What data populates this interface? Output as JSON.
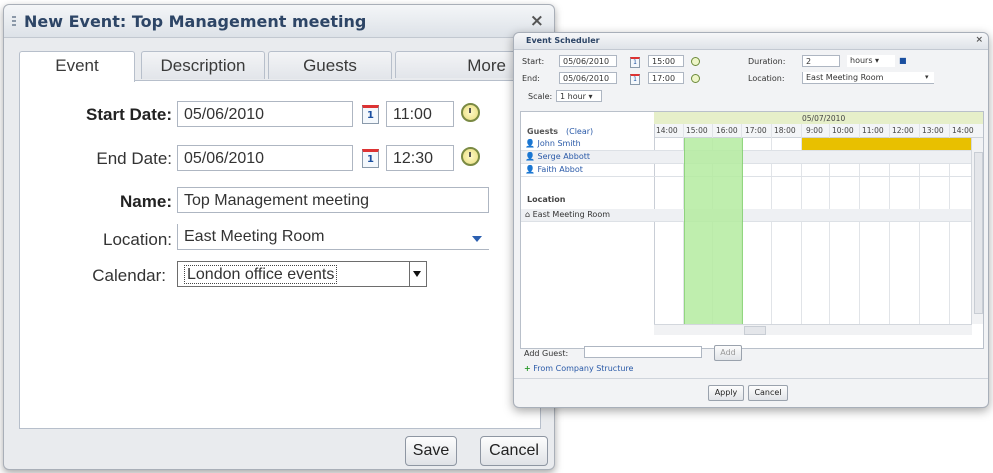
{
  "event_dialog": {
    "title": "New Event: Top Management meeting",
    "close_glyph": "×",
    "tabs": [
      {
        "label": "Event",
        "active": true
      },
      {
        "label": "Description",
        "active": false
      },
      {
        "label": "Guests",
        "active": false
      },
      {
        "label": "More",
        "active": false
      }
    ],
    "start_date": {
      "label": "Start Date:",
      "date": "05/06/2010",
      "time": "11:00"
    },
    "end_date": {
      "label": "End Date:",
      "date": "05/06/2010",
      "time": "12:30"
    },
    "name": {
      "label": "Name:",
      "value": "Top Management meeting"
    },
    "location": {
      "label": "Location:",
      "value": "East Meeting Room"
    },
    "calendar": {
      "label": "Calendar:",
      "value": "London office events"
    },
    "calendar_icon_text": "1",
    "save_label": "Save",
    "cancel_label": "Cancel"
  },
  "scheduler": {
    "title": "Event Scheduler",
    "close_glyph": "×",
    "start": {
      "label": "Start:",
      "date": "05/06/2010",
      "time": "15:00"
    },
    "end": {
      "label": "End:",
      "date": "05/06/2010",
      "time": "17:00"
    },
    "duration": {
      "label": "Duration:",
      "value": "2",
      "unit": "hours"
    },
    "location": {
      "label": "Location:",
      "value": "East Meeting Room"
    },
    "scale": {
      "label": "Scale:",
      "value": "1 hour"
    },
    "date_header": "05/07/2010",
    "time_columns": [
      "14:00",
      "15:00",
      "16:00",
      "17:00",
      "18:00",
      "9:00",
      "10:00",
      "11:00",
      "12:00",
      "13:00",
      "14:00"
    ],
    "guests_header": "Guests",
    "clear_label": "(Clear)",
    "guests": [
      "John Smith",
      "Serge Abbott",
      "Faith Abbot"
    ],
    "location_header": "Location",
    "locations": [
      "East Meeting Room"
    ],
    "add_guest_label": "Add Guest:",
    "add_button": "Add",
    "from_structure": "From Company Structure",
    "apply_label": "Apply",
    "cancel_label": "Cancel",
    "colors": {
      "selection": "#b5eca0",
      "busy": "#e8c000"
    }
  }
}
